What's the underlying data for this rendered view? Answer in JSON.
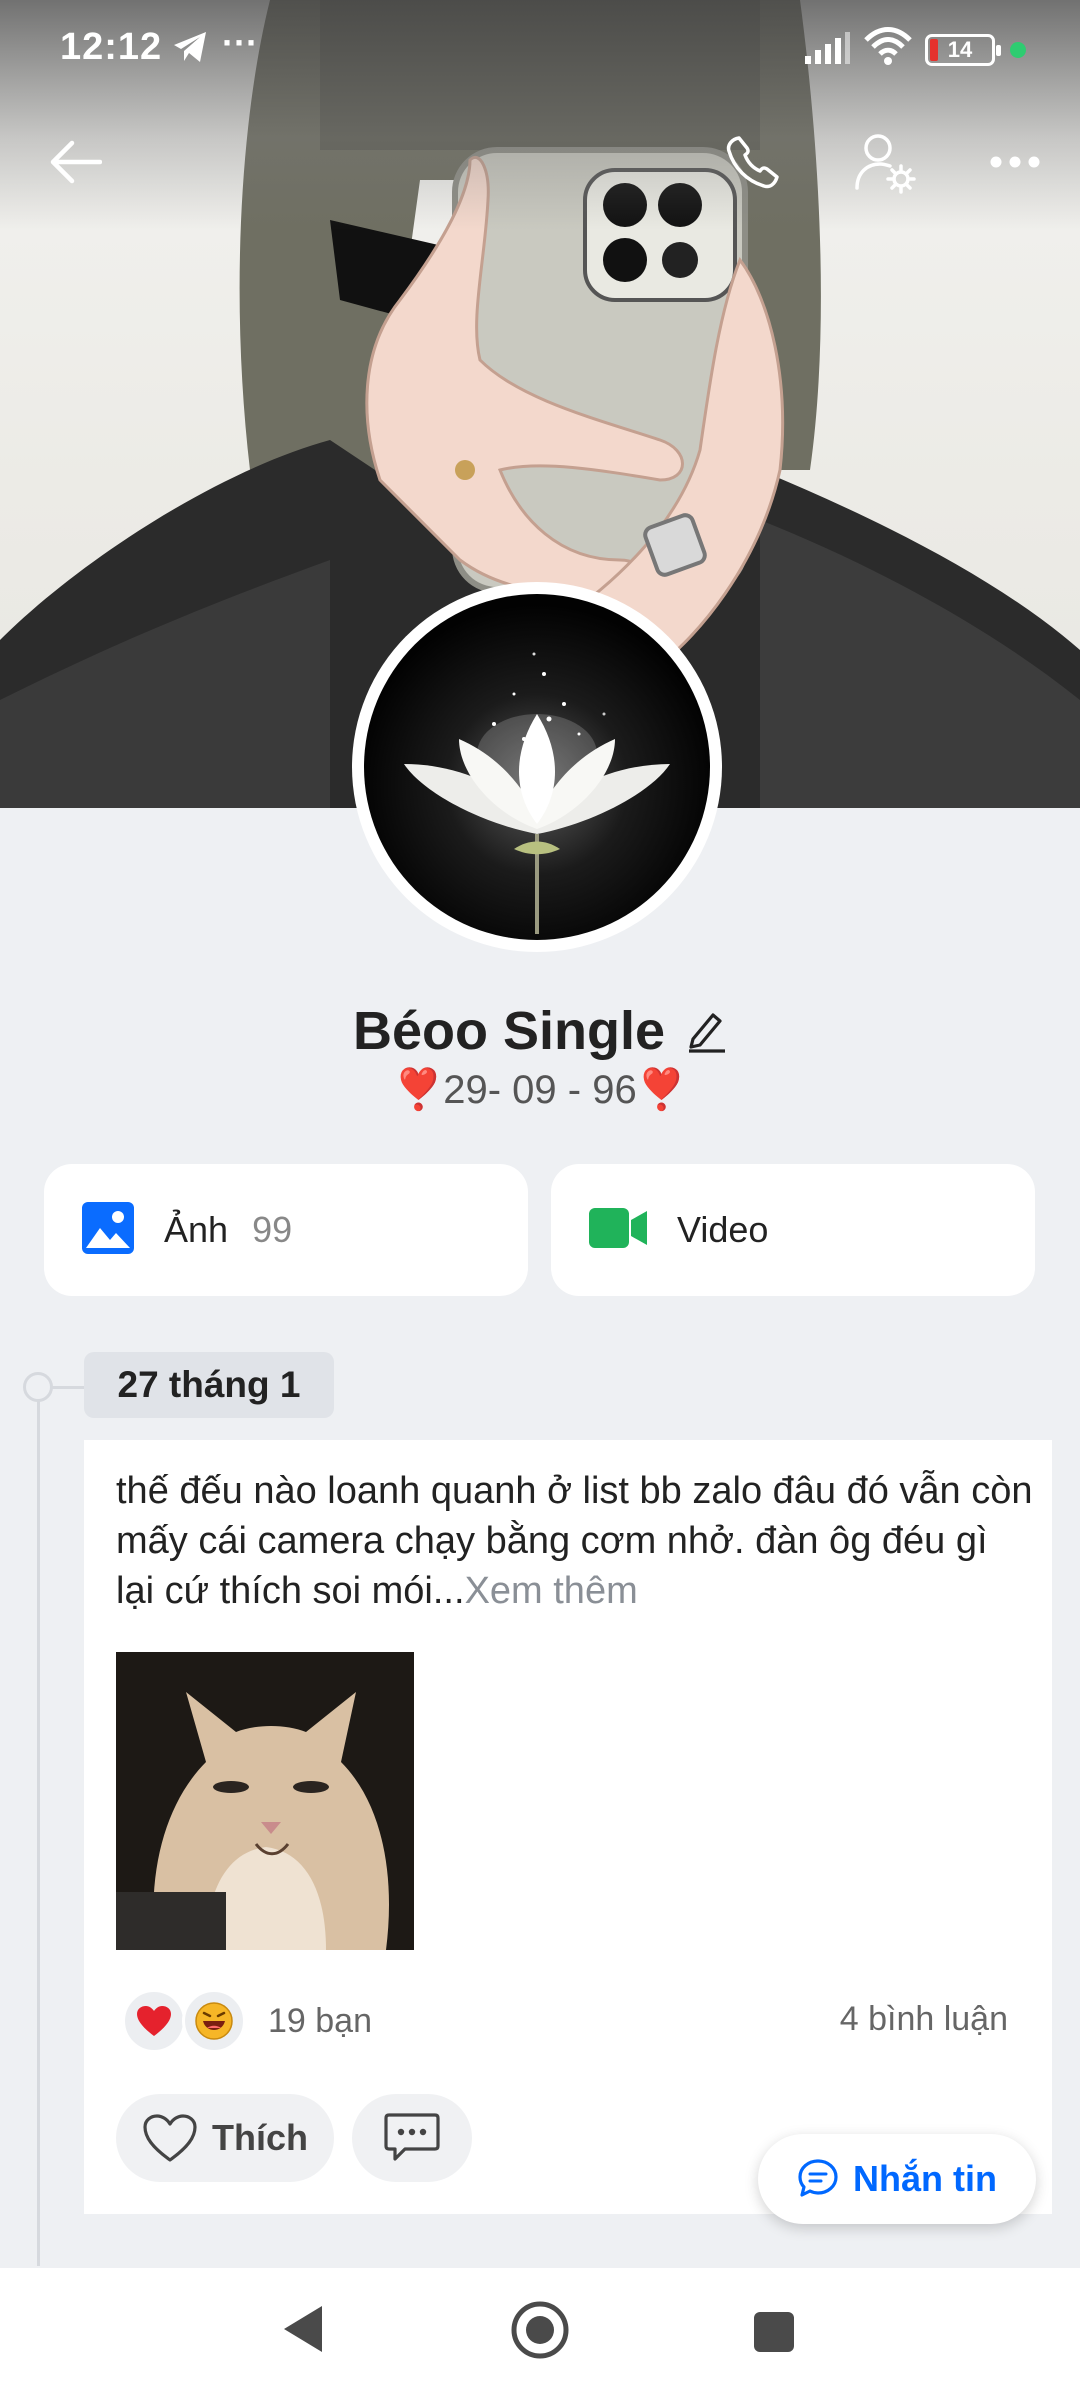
{
  "status_bar": {
    "time": "12:12",
    "battery_level": "14",
    "icons": [
      "telegram-icon",
      "more-dots-icon",
      "signal-icon",
      "wifi-icon",
      "battery-icon"
    ]
  },
  "header": {
    "icons": [
      "back-arrow-icon",
      "phone-icon",
      "user-settings-icon",
      "more-icon"
    ]
  },
  "profile": {
    "name": "Béoo Single",
    "bio": "❣️29- 09 - 96❣️"
  },
  "media": {
    "photo_label": "Ảnh",
    "photo_count": "99",
    "video_label": "Video"
  },
  "timeline": {
    "date": "27 tháng 1",
    "post": {
      "text": "thế đếu nào loanh quanh ở list bb zalo đâu đó vẫn còn mấy cái camera chạy bằng cơm nhở. đàn ôg đéu gì lại cứ thích soi mói...",
      "see_more": "Xem thêm",
      "reactions": [
        "heart",
        "laugh"
      ],
      "reaction_count": "19 bạn",
      "comment_count": "4 bình luận",
      "like_label": "Thích"
    }
  },
  "message_button": "Nhắn tin",
  "colors": {
    "accent": "#0068ff",
    "photo_icon": "#0a6cff",
    "video_icon": "#20b35a",
    "background": "#eef0f3"
  }
}
